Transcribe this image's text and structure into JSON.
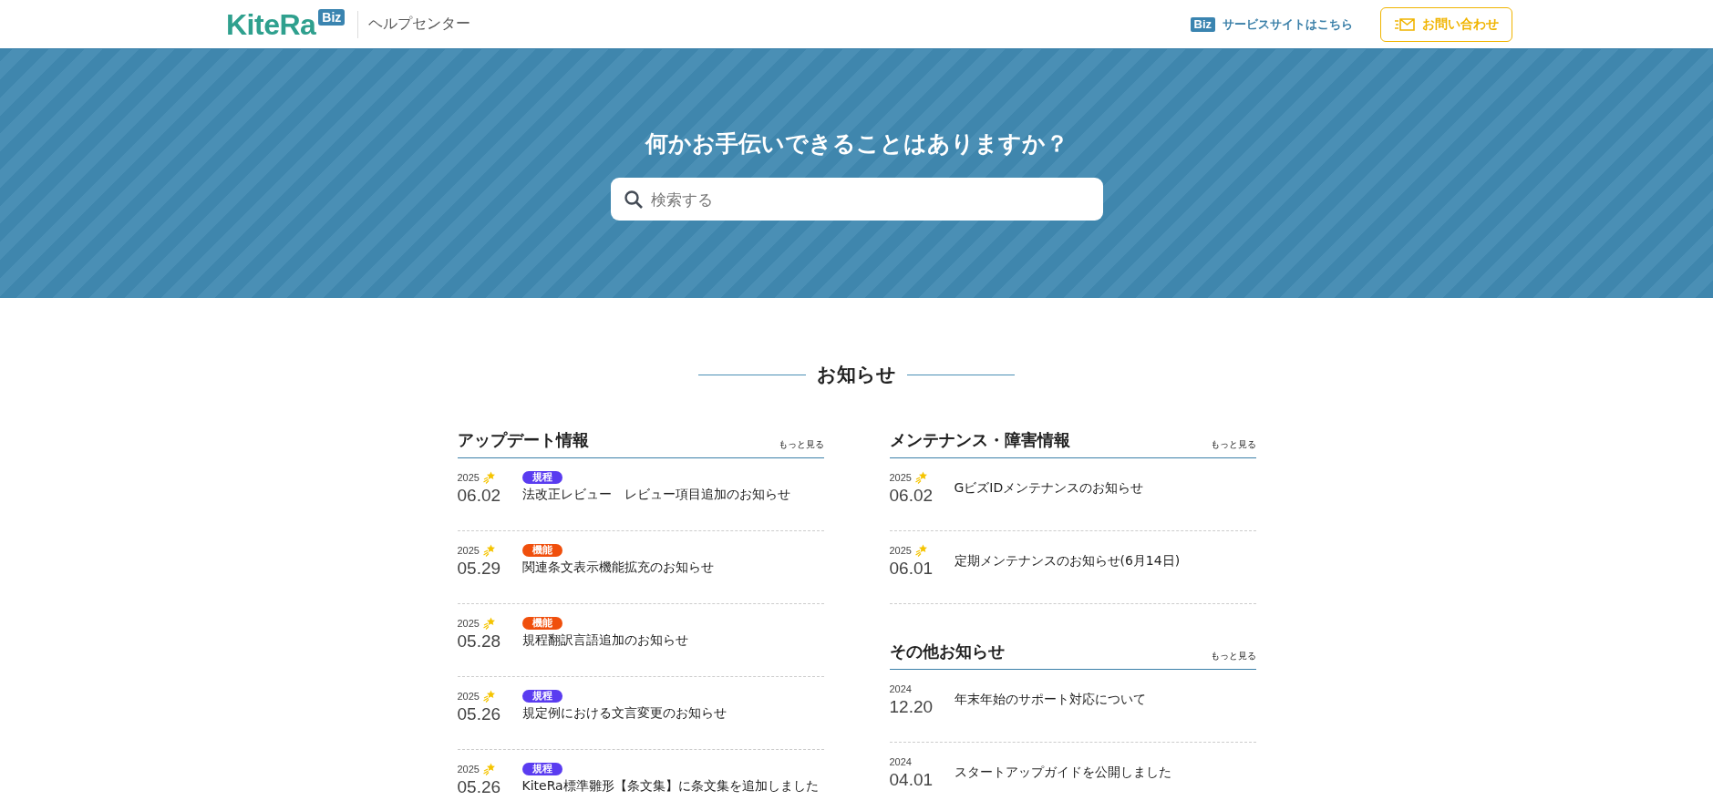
{
  "header": {
    "logo": "KiteRa",
    "logo_badge": "Biz",
    "site_title": "ヘルプセンター",
    "service_badge": "Biz",
    "service_link": "サービスサイトはこちら",
    "contact_button": "お問い合わせ"
  },
  "hero": {
    "title": "何かお手伝いできることはありますか？",
    "search": {
      "placeholder": "検索する"
    }
  },
  "news": {
    "heading": "お知らせ",
    "columns": [
      {
        "sections": [
          {
            "title": "アップデート情報",
            "more": "もっと見る",
            "items": [
              {
                "year": "2025",
                "new": true,
                "date": "06.02",
                "tag": {
                  "label": "規程",
                  "color": "#5a3cf0"
                },
                "title": "法改正レビュー　レビュー項目追加のお知らせ"
              },
              {
                "year": "2025",
                "new": true,
                "date": "05.29",
                "tag": {
                  "label": "機能",
                  "color": "#f04f0c"
                },
                "title": "関連条文表示機能拡充のお知らせ"
              },
              {
                "year": "2025",
                "new": true,
                "date": "05.28",
                "tag": {
                  "label": "機能",
                  "color": "#f04f0c"
                },
                "title": "規程翻訳言語追加のお知らせ"
              },
              {
                "year": "2025",
                "new": true,
                "date": "05.26",
                "tag": {
                  "label": "規程",
                  "color": "#5a3cf0"
                },
                "title": "規定例における文言変更のお知らせ"
              },
              {
                "year": "2025",
                "new": true,
                "date": "05.26",
                "tag": {
                  "label": "規程",
                  "color": "#5a3cf0"
                },
                "title": "KiteRa標準雛形【条文集】に条文集を追加しました"
              }
            ]
          }
        ]
      },
      {
        "sections": [
          {
            "title": "メンテナンス・障害情報",
            "more": "もっと見る",
            "items": [
              {
                "year": "2025",
                "new": true,
                "date": "06.02",
                "title": "GビズIDメンテナンスのお知らせ"
              },
              {
                "year": "2025",
                "new": true,
                "date": "06.01",
                "title": "定期メンテナンスのお知らせ(6月14日)"
              }
            ]
          },
          {
            "title": "その他お知らせ",
            "more": "もっと見る",
            "items": [
              {
                "year": "2024",
                "new": false,
                "date": "12.20",
                "title": "年末年始のサポート対応について"
              },
              {
                "year": "2024",
                "new": false,
                "date": "04.01",
                "title": "スタートアップガイドを公開しました"
              }
            ]
          }
        ]
      }
    ]
  }
}
